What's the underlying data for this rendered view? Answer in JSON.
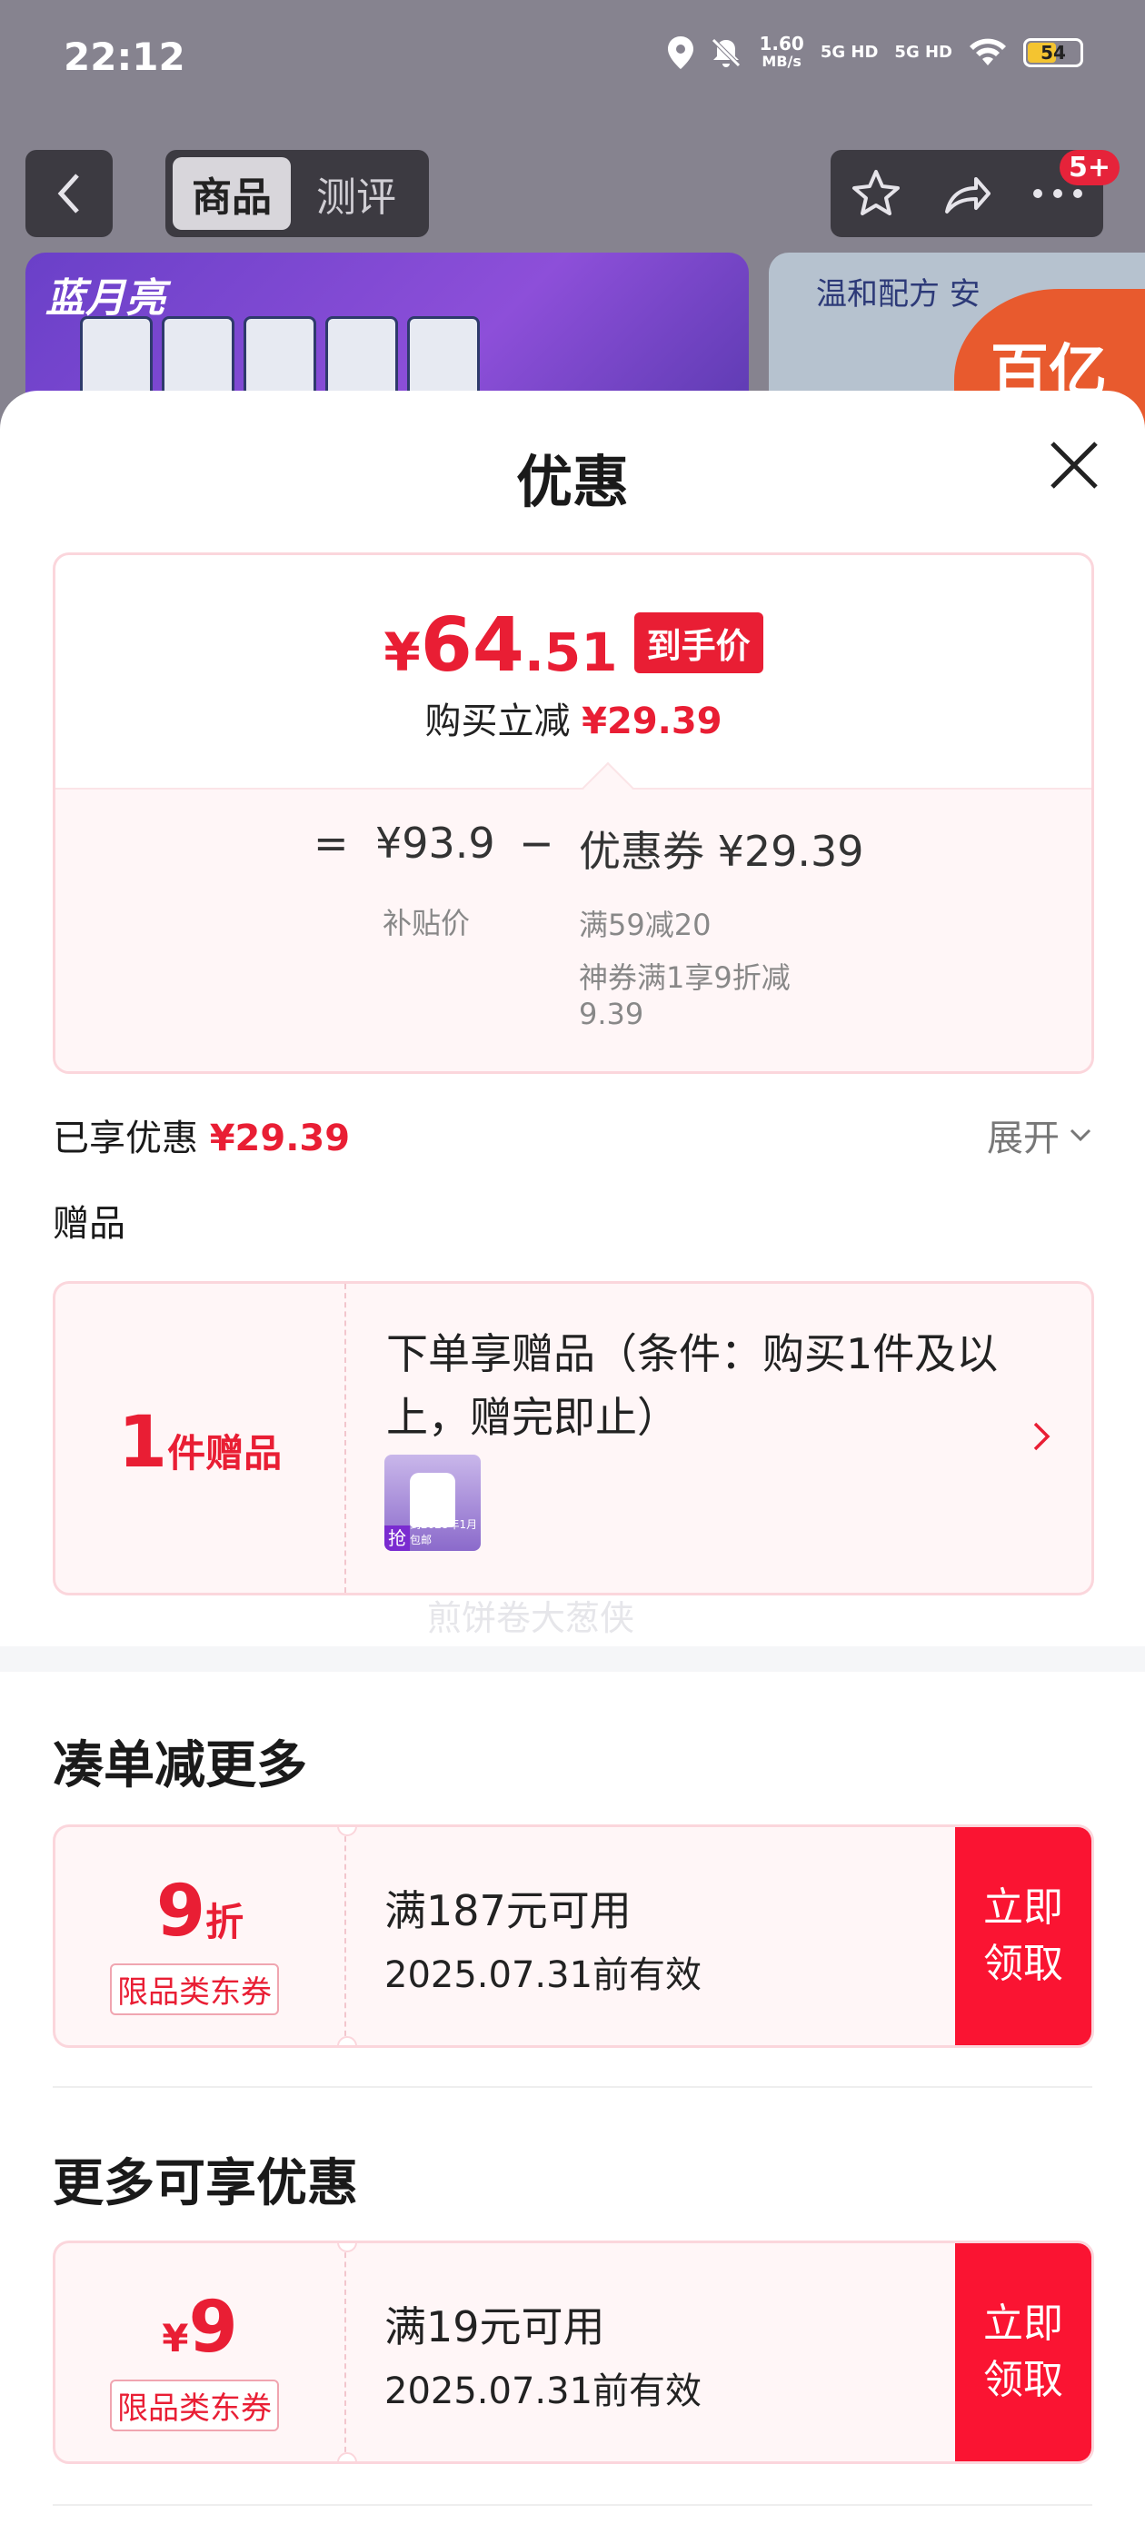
{
  "status_bar": {
    "time": "22:12",
    "speed": "1.60",
    "speed_unit": "MB/s",
    "net1": "5G HD",
    "net2": "5G HD",
    "battery": "54"
  },
  "header": {
    "tab_active": "商品",
    "tab_inactive": "测评",
    "badge": "5+"
  },
  "banner": {
    "brand": "蓝月亮",
    "right_text": "温和配方 安",
    "right_big": "百亿补贴"
  },
  "sheet": {
    "title": "优惠"
  },
  "price": {
    "currency": "¥",
    "final_int": "64",
    "final_dec": ".51",
    "final_tag": "到手价",
    "reduce_label": "购买立减",
    "reduce_value": "¥29.39",
    "eq": "=",
    "base": "¥93.9",
    "base_label": "补贴价",
    "minus": "−",
    "coupon": "优惠券 ¥29.39",
    "coupon_detail1": "满59减20",
    "coupon_detail2": "神券满1享9折减",
    "coupon_detail3": "9.39"
  },
  "enjoyed": {
    "label": "已享优惠",
    "value": "¥29.39",
    "expand": "展开"
  },
  "gift": {
    "section": "赠品",
    "count": "1",
    "unit": "件赠品",
    "desc": "下单享赠品（条件：购买1件及以上，赠完即止）",
    "thumb_tag": "抢",
    "thumb_text": "到2028年1月包邮"
  },
  "watermark": "煎饼卷大葱侠",
  "sections": {
    "more_title": "凑单减更多",
    "extra_title": "更多可享优惠"
  },
  "coupons": [
    {
      "amount": "9",
      "unit": "折",
      "prefix": "",
      "limit": "限品类东券",
      "condition": "满187元可用",
      "date": "2025.07.31前有效",
      "button": "立即领取"
    },
    {
      "amount": "9",
      "unit": "",
      "prefix": "¥",
      "limit": "限品类东券",
      "condition": "满19元可用",
      "date": "2025.07.31前有效",
      "button": "立即领取"
    }
  ],
  "colors": {
    "accent": "#e91e34",
    "button": "#fa1432"
  }
}
